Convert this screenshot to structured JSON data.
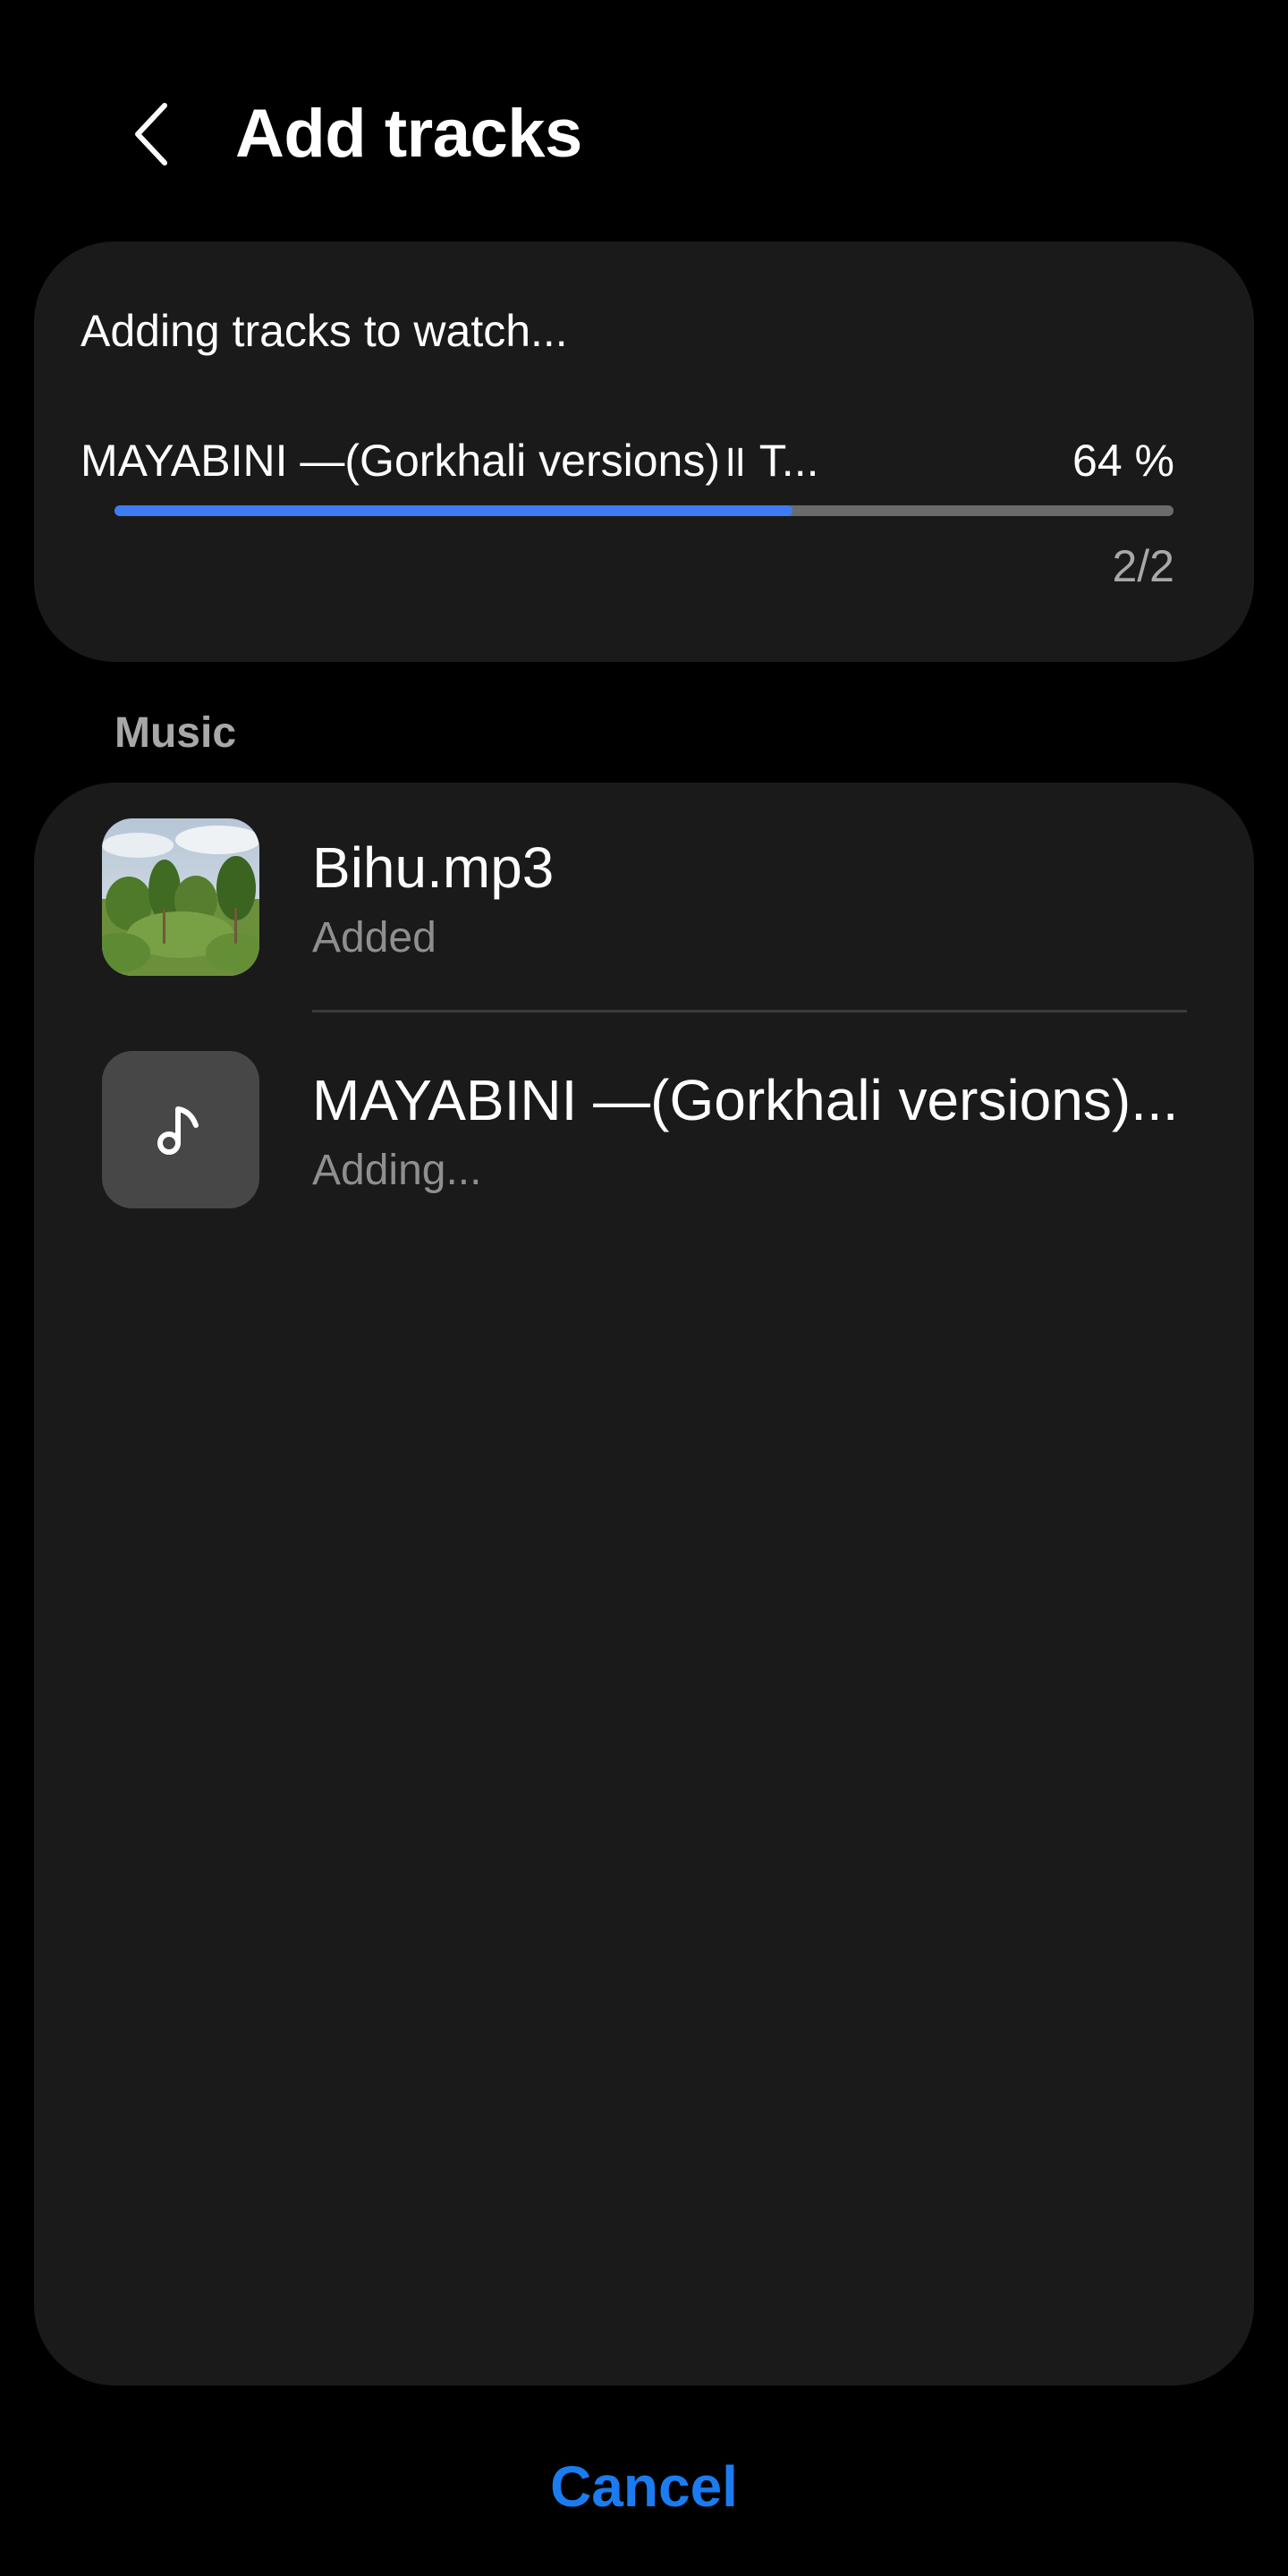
{
  "header": {
    "back_icon": "chevron-left-icon",
    "title": "Add tracks"
  },
  "progress": {
    "heading": "Adding tracks to watch...",
    "current_track": "MAYABINI —(Gorkhali versions)॥ T...",
    "percent_label": "64 %",
    "percent_value": 0.64,
    "count": "2/2",
    "fill_color": "#3e7cf5"
  },
  "music": {
    "section_label": "Music",
    "items": [
      {
        "title": "Bihu.mp3",
        "status": "Added",
        "artwork": "forest-landscape-thumbnail"
      },
      {
        "title": "MAYABINI —(Gorkhali versions)...",
        "status": "Adding...",
        "artwork": "music-note-icon"
      }
    ]
  },
  "footer": {
    "cancel_label": "Cancel",
    "accent_color": "#1a7cf0"
  }
}
